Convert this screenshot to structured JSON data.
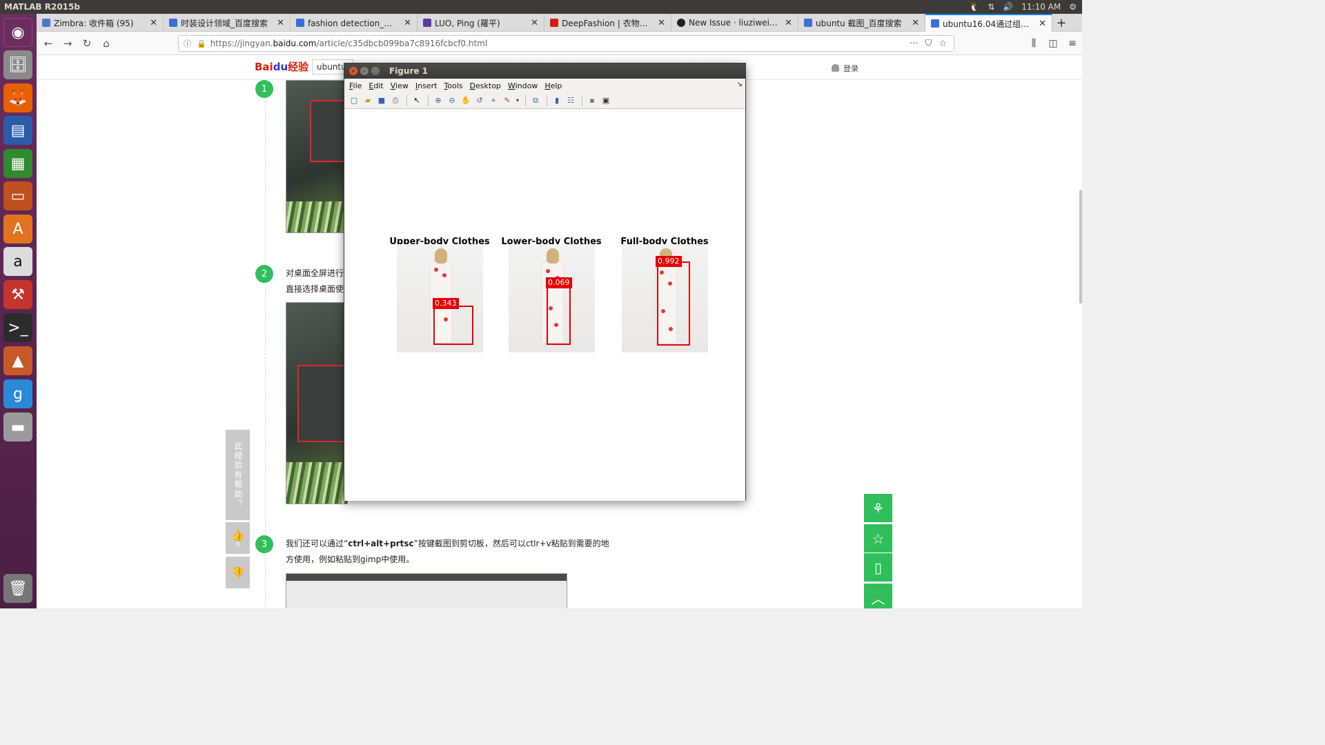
{
  "top_panel": {
    "app_title": "MATLAB R2015b",
    "time": "11:10 AM"
  },
  "launcher": {
    "items": [
      "ubuntu-home-icon",
      "files-icon",
      "firefox-icon",
      "writer-icon",
      "calc-icon",
      "impress-icon",
      "software-center-icon",
      "amazon-icon",
      "system-settings-icon",
      "terminal-icon",
      "matlab-icon",
      "app-icon",
      "drive-icon",
      "trash-icon"
    ]
  },
  "browser": {
    "tabs": [
      {
        "label": "Zimbra: 收件箱 (95)",
        "color": "#4a7bd0"
      },
      {
        "label": "时装设计领域_百度搜索",
        "color": "#3a6fd8"
      },
      {
        "label": "fashion detection_百度",
        "color": "#3a6fd8"
      },
      {
        "label": "LUO, Ping (羅平)",
        "color": "#5a3aa8"
      },
      {
        "label": "DeepFashion | 衣物时尚",
        "color": "#d81e06"
      },
      {
        "label": "New Issue · liuziwei7/fa",
        "color": "#222222"
      },
      {
        "label": "ubuntu 截图_百度搜索",
        "color": "#3a6fd8"
      },
      {
        "label": "ubuntu16.04通过组合键",
        "color": "#3a6fd8",
        "active": true
      }
    ],
    "url_prefix": "https://jingyan.",
    "url_domain": "baidu.com",
    "url_suffix": "/article/c35dbcb099ba7c8916fcbcf0.html"
  },
  "page": {
    "logo_bai": "Bai",
    "logo_du": "du",
    "logo_jingyan": "经验",
    "search_value": "ubuntu",
    "login_label": "登录",
    "steps": [
      {
        "num": "1"
      },
      {
        "num": "2",
        "line1": "对桌面全屏进行",
        "line2": "直接选择桌面使"
      },
      {
        "num": "3",
        "line1_pre": "我们还可以通过“",
        "line1_bold": "ctrl+alt+prtsc",
        "line1_post": "”按键截图到剪切板，然后可以ctlr+v粘贴到需要的地",
        "line2": "方使用，例如粘贴到gimp中使用。"
      }
    ],
    "helpful_text": "此经验有帮助？",
    "like_count": "0"
  },
  "figure": {
    "title": "Figure 1",
    "menus": [
      "File",
      "Edit",
      "View",
      "Insert",
      "Tools",
      "Desktop",
      "Window",
      "Help"
    ],
    "panels": [
      {
        "title": "Upper-body Clothes",
        "score": "0.343"
      },
      {
        "title": "Lower-body Clothes",
        "score": "0.069"
      },
      {
        "title": "Full-body Clothes",
        "score": "0.992"
      }
    ]
  }
}
